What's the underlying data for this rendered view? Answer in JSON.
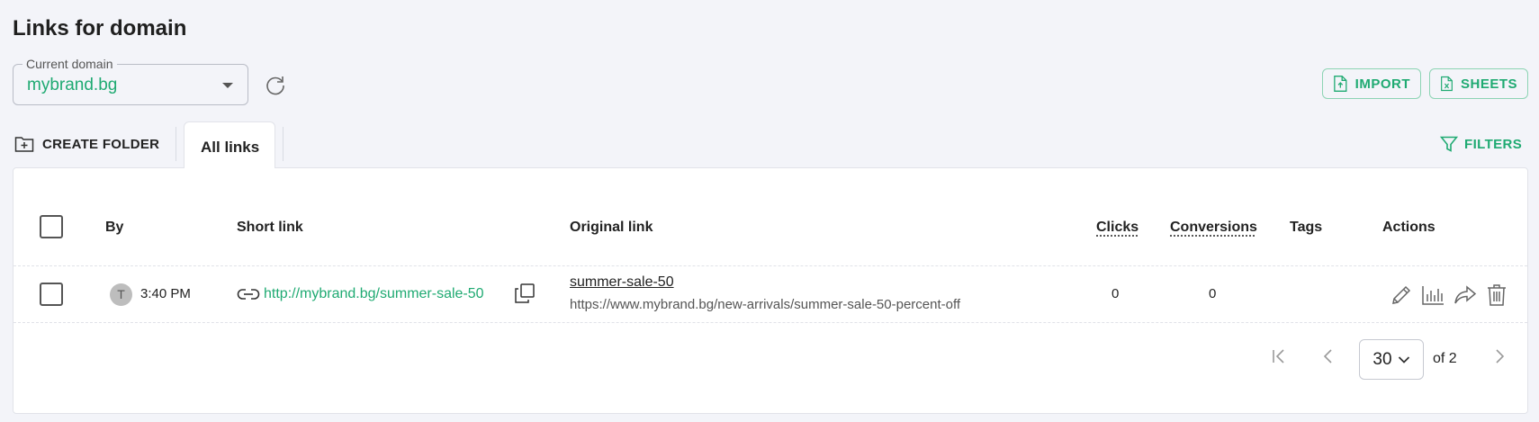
{
  "page": {
    "title": "Links for domain"
  },
  "domain": {
    "label": "Current domain",
    "value": "mybrand.bg"
  },
  "buttons": {
    "import": "IMPORT",
    "sheets": "SHEETS",
    "create_folder": "CREATE FOLDER",
    "filters": "FILTERS"
  },
  "tabs": {
    "active": "All links"
  },
  "table": {
    "headers": {
      "by": "By",
      "short_link": "Short link",
      "original_link": "Original link",
      "clicks": "Clicks",
      "conversions": "Conversions",
      "tags": "Tags",
      "actions": "Actions"
    },
    "rows": [
      {
        "avatar_initial": "T",
        "time": "3:40 PM",
        "short_link": "http://mybrand.bg/summer-sale-50",
        "original_title": "summer-sale-50",
        "original_url": "https://www.mybrand.bg/new-arrivals/summer-sale-50-percent-off",
        "clicks": "0",
        "conversions": "0"
      }
    ]
  },
  "pagination": {
    "page_size": "30",
    "of_pages": "of 2"
  },
  "colors": {
    "accent": "#1faa72",
    "background": "#f3f4f9"
  },
  "icons": [
    "refresh-icon",
    "import-file-icon",
    "sheets-file-icon",
    "create-folder-icon",
    "filter-icon",
    "link-icon",
    "copy-icon",
    "edit-icon",
    "stats-icon",
    "share-icon",
    "delete-icon",
    "first-page-icon",
    "prev-page-icon",
    "next-page-icon",
    "chevron-down-icon"
  ]
}
